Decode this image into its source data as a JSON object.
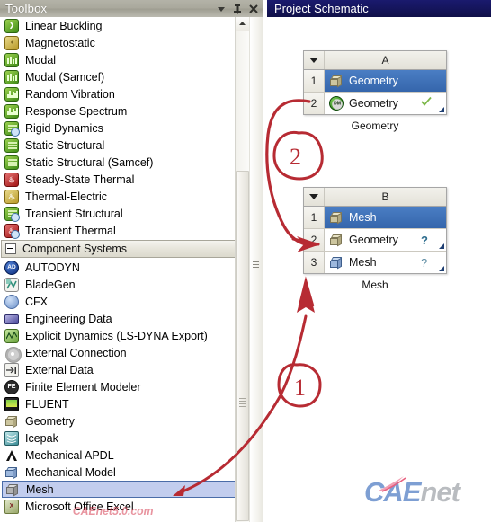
{
  "toolbox": {
    "title": "Toolbox",
    "header_icons": [
      {
        "name": "chevron-down-icon",
        "glyph": "▾"
      },
      {
        "name": "pin-icon",
        "glyph": "📌"
      },
      {
        "name": "close-icon",
        "glyph": "✕"
      }
    ],
    "analysis_items": [
      {
        "label": "Linear Buckling",
        "icon": "linear-buckling-icon"
      },
      {
        "label": "Magnetostatic",
        "icon": "magnetostatic-icon"
      },
      {
        "label": "Modal",
        "icon": "modal-icon"
      },
      {
        "label": "Modal (Samcef)",
        "icon": "modal-samcef-icon"
      },
      {
        "label": "Random Vibration",
        "icon": "random-vibration-icon"
      },
      {
        "label": "Response Spectrum",
        "icon": "response-spectrum-icon"
      },
      {
        "label": "Rigid Dynamics",
        "icon": "rigid-dynamics-icon"
      },
      {
        "label": "Static Structural",
        "icon": "static-structural-icon"
      },
      {
        "label": "Static Structural (Samcef)",
        "icon": "static-structural-samcef-icon"
      },
      {
        "label": "Steady-State Thermal",
        "icon": "steady-state-thermal-icon"
      },
      {
        "label": "Thermal-Electric",
        "icon": "thermal-electric-icon"
      },
      {
        "label": "Transient Structural",
        "icon": "transient-structural-icon"
      },
      {
        "label": "Transient Thermal",
        "icon": "transient-thermal-icon"
      }
    ],
    "group_header": "Component Systems",
    "component_items": [
      {
        "label": "AUTODYN",
        "icon": "autodyn-icon"
      },
      {
        "label": "BladeGen",
        "icon": "bladegen-icon"
      },
      {
        "label": "CFX",
        "icon": "cfx-icon"
      },
      {
        "label": "Engineering Data",
        "icon": "engineering-data-icon"
      },
      {
        "label": "Explicit Dynamics (LS-DYNA Export)",
        "icon": "explicit-dynamics-icon"
      },
      {
        "label": "External Connection",
        "icon": "external-connection-icon"
      },
      {
        "label": "External Data",
        "icon": "external-data-icon"
      },
      {
        "label": "Finite Element Modeler",
        "icon": "finite-element-modeler-icon"
      },
      {
        "label": "FLUENT",
        "icon": "fluent-icon"
      },
      {
        "label": "Geometry",
        "icon": "geometry-icon"
      },
      {
        "label": "Icepak",
        "icon": "icepak-icon"
      },
      {
        "label": "Mechanical APDL",
        "icon": "mechanical-apdl-icon"
      },
      {
        "label": "Mechanical Model",
        "icon": "mechanical-model-icon"
      },
      {
        "label": "Mesh",
        "icon": "mesh-icon",
        "selected": true
      },
      {
        "label": "Microsoft Office Excel",
        "icon": "excel-icon"
      }
    ]
  },
  "schematic": {
    "title": "Project Schematic",
    "systems": [
      {
        "letter": "A",
        "caption": "Geometry",
        "rows": [
          {
            "num": "1",
            "label": "Geometry",
            "icon": "geometry-header-icon",
            "highlighted": true,
            "status": "",
            "has_corner": false
          },
          {
            "num": "2",
            "label": "Geometry",
            "icon": "design-modeler-icon",
            "highlighted": false,
            "status": "check",
            "has_corner": true
          }
        ]
      },
      {
        "letter": "B",
        "caption": "Mesh",
        "rows": [
          {
            "num": "1",
            "label": "Mesh",
            "icon": "mesh-header-icon",
            "highlighted": true,
            "status": "",
            "has_corner": false
          },
          {
            "num": "2",
            "label": "Geometry",
            "icon": "geometry-cube-icon",
            "highlighted": false,
            "status": "question-solid",
            "has_corner": true
          },
          {
            "num": "3",
            "label": "Mesh",
            "icon": "mesh-cube-icon",
            "highlighted": false,
            "status": "question-outline",
            "has_corner": true
          }
        ]
      }
    ]
  },
  "annotations": [
    {
      "name": "annotation-step-1",
      "label": "1"
    },
    {
      "name": "annotation-step-2",
      "label": "2"
    }
  ],
  "watermarks": {
    "caenet_primary": "CAE",
    "caenet_secondary": "net",
    "overlay_text": "CAEnet5.0.com"
  },
  "colors": {
    "accent_blue": "#3566ac",
    "header_navy": "#15155c",
    "annotation_red": "#b72b33",
    "selection_fill": "#c2cdee",
    "watermark_blue": "#7e9fd3"
  }
}
